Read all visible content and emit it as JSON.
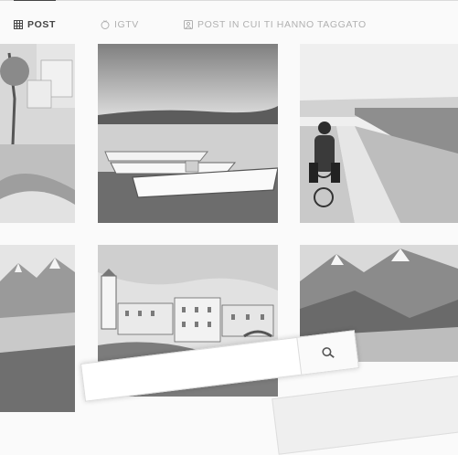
{
  "tabs": [
    {
      "label": "POST",
      "icon": "grid-icon",
      "active": true
    },
    {
      "label": "IGTV",
      "icon": "igtv-icon",
      "active": false
    },
    {
      "label": "POST IN CUI TI HANNO TAGGATO",
      "icon": "tagged-icon",
      "active": false
    }
  ],
  "search": {
    "placeholder": "",
    "icon": "search-icon"
  },
  "colors": {
    "active": "#444444",
    "inactive": "#b0b0b0",
    "border": "#dbdbdb"
  }
}
